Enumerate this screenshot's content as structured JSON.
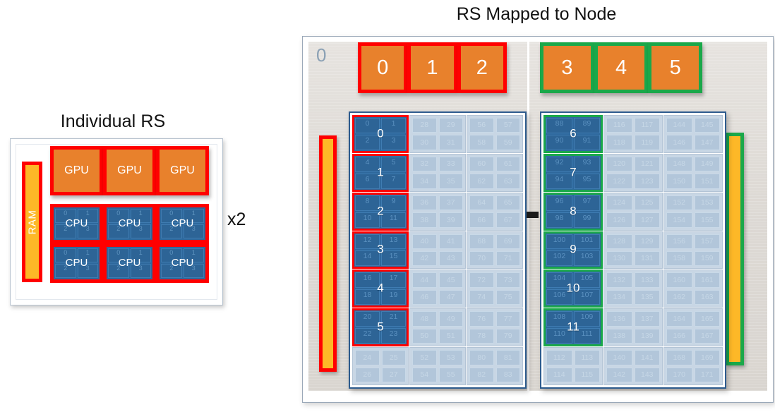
{
  "left_panel": {
    "title": "Individual RS",
    "ram_label": "RAM",
    "multiplier": "x2",
    "gpu_label": "GPU",
    "cpu_label": "CPU",
    "cpu_quad_labels": [
      "0",
      "1",
      "2",
      "3"
    ],
    "gpus": [
      "GPU",
      "GPU",
      "GPU"
    ],
    "cpus": [
      "CPU",
      "CPU",
      "CPU",
      "CPU",
      "CPU",
      "CPU"
    ]
  },
  "right_panel": {
    "title": "RS Mapped to Node",
    "node_id": "0",
    "gpu_groups": [
      {
        "accent": "#ff0000",
        "labels": [
          "0",
          "1",
          "2"
        ]
      },
      {
        "accent": "#1aa84a",
        "labels": [
          "3",
          "4",
          "5"
        ]
      }
    ],
    "ram_bars": [
      {
        "side": "left",
        "accent": "#ff0000"
      },
      {
        "side": "right",
        "accent": "#1aa84a"
      }
    ],
    "sockets": [
      {
        "name": "socket-left",
        "accent": "#ff0000",
        "columns": [
          {
            "start": 0,
            "end": 27
          },
          {
            "start": 28,
            "end": 55
          },
          {
            "start": 56,
            "end": 83
          }
        ],
        "active_rows": [
          0,
          1,
          2,
          3,
          4,
          5
        ],
        "rs_labels": [
          "0",
          "1",
          "2",
          "3",
          "4",
          "5"
        ],
        "cells": [
          [
            [
              "0",
              "1",
              "2",
              "3"
            ],
            [
              "28",
              "29",
              "30",
              "31"
            ],
            [
              "56",
              "57",
              "58",
              "59"
            ]
          ],
          [
            [
              "4",
              "5",
              "6",
              "7"
            ],
            [
              "32",
              "33",
              "34",
              "35"
            ],
            [
              "60",
              "61",
              "62",
              "63"
            ]
          ],
          [
            [
              "8",
              "9",
              "10",
              "11"
            ],
            [
              "36",
              "37",
              "38",
              "39"
            ],
            [
              "64",
              "65",
              "66",
              "67"
            ]
          ],
          [
            [
              "12",
              "13",
              "14",
              "15"
            ],
            [
              "40",
              "41",
              "42",
              "43"
            ],
            [
              "68",
              "69",
              "70",
              "71"
            ]
          ],
          [
            [
              "16",
              "17",
              "18",
              "19"
            ],
            [
              "44",
              "45",
              "46",
              "47"
            ],
            [
              "72",
              "73",
              "74",
              "75"
            ]
          ],
          [
            [
              "20",
              "21",
              "22",
              "23"
            ],
            [
              "48",
              "49",
              "50",
              "51"
            ],
            [
              "76",
              "77",
              "78",
              "79"
            ]
          ],
          [
            [
              "24",
              "25",
              "26",
              "27"
            ],
            [
              "52",
              "53",
              "54",
              "55"
            ],
            [
              "80",
              "81",
              "82",
              "83"
            ]
          ]
        ]
      },
      {
        "name": "socket-right",
        "accent": "#1aa84a",
        "columns": [
          {
            "start": 88,
            "end": 115
          },
          {
            "start": 116,
            "end": 143
          },
          {
            "start": 144,
            "end": 171
          }
        ],
        "active_rows": [
          0,
          1,
          2,
          3,
          4,
          5
        ],
        "rs_labels": [
          "6",
          "7",
          "8",
          "9",
          "10",
          "11"
        ],
        "cells": [
          [
            [
              "88",
              "89",
              "90",
              "91"
            ],
            [
              "116",
              "117",
              "118",
              "119"
            ],
            [
              "144",
              "145",
              "146",
              "147"
            ]
          ],
          [
            [
              "92",
              "93",
              "94",
              "95"
            ],
            [
              "120",
              "121",
              "122",
              "123"
            ],
            [
              "148",
              "149",
              "150",
              "151"
            ]
          ],
          [
            [
              "96",
              "97",
              "98",
              "99"
            ],
            [
              "124",
              "125",
              "126",
              "127"
            ],
            [
              "152",
              "153",
              "154",
              "155"
            ]
          ],
          [
            [
              "100",
              "101",
              "102",
              "103"
            ],
            [
              "128",
              "129",
              "130",
              "131"
            ],
            [
              "156",
              "157",
              "158",
              "159"
            ]
          ],
          [
            [
              "104",
              "105",
              "106",
              "107"
            ],
            [
              "132",
              "133",
              "134",
              "135"
            ],
            [
              "160",
              "161",
              "162",
              "163"
            ]
          ],
          [
            [
              "108",
              "109",
              "110",
              "111"
            ],
            [
              "136",
              "137",
              "138",
              "139"
            ],
            [
              "164",
              "165",
              "166",
              "167"
            ]
          ],
          [
            [
              "112",
              "113",
              "114",
              "115"
            ],
            [
              "140",
              "141",
              "142",
              "143"
            ],
            [
              "168",
              "169",
              "170",
              "171"
            ]
          ]
        ]
      }
    ]
  },
  "colors": {
    "gpu_fill": "#e8812c",
    "cpu_active_fill": "#2e689c",
    "cpu_idle_fill": "#c5d3e2",
    "ram_fill": "#fdb827",
    "accent_red": "#ff0000",
    "accent_green": "#1aa84a",
    "node_bg": "#ddd9d4",
    "socket_border": "#2d5b8e"
  }
}
